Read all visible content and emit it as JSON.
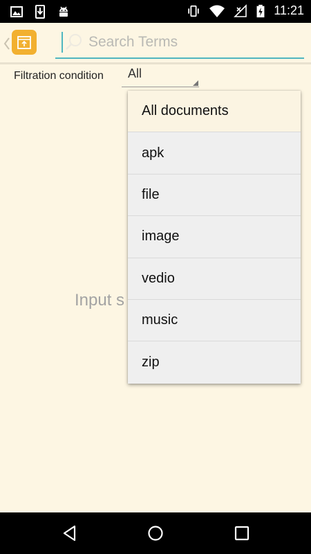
{
  "status_bar": {
    "time": "11:21",
    "left_icons": [
      "image-icon",
      "download-icon",
      "android-icon"
    ],
    "right_icons": [
      "vibrate-icon",
      "wifi-icon",
      "no-signal-icon",
      "battery-charging-icon"
    ]
  },
  "search": {
    "placeholder": "Search Terms",
    "value": ""
  },
  "filter": {
    "label": "Filtration condition",
    "selected": "All"
  },
  "hint": {
    "text": "Input s"
  },
  "dropdown": {
    "options": [
      {
        "label": "All documents",
        "selected": true
      },
      {
        "label": "apk",
        "selected": false
      },
      {
        "label": "file",
        "selected": false
      },
      {
        "label": "image",
        "selected": false
      },
      {
        "label": "vedio",
        "selected": false
      },
      {
        "label": "music",
        "selected": false
      },
      {
        "label": "zip",
        "selected": false
      }
    ]
  },
  "colors": {
    "background": "#fdf6e3",
    "accent": "#4fb6c0",
    "logo": "#f2b030"
  },
  "nav_bar": {
    "icons": [
      "back-icon",
      "home-icon",
      "recents-icon"
    ]
  }
}
